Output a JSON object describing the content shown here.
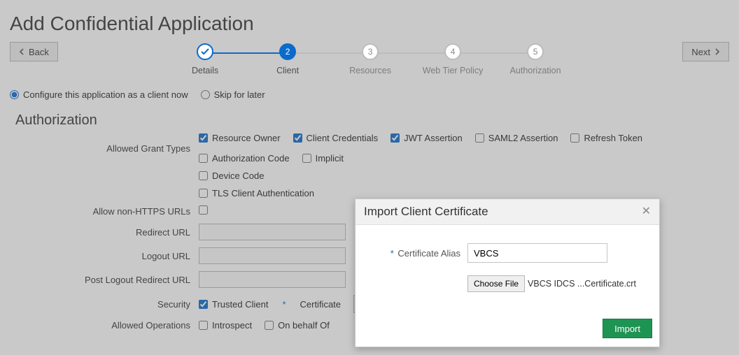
{
  "header": {
    "title": "Add Confidential Application",
    "back_label": "Back",
    "next_label": "Next"
  },
  "stepper": {
    "steps": [
      {
        "num_icon": "check",
        "label": "Details"
      },
      {
        "num_icon": "2",
        "label": "Client"
      },
      {
        "num_icon": "3",
        "label": "Resources"
      },
      {
        "num_icon": "4",
        "label": "Web Tier Policy"
      },
      {
        "num_icon": "5",
        "label": "Authorization"
      }
    ]
  },
  "config_choice": {
    "now_label": "Configure this application as a client now",
    "later_label": "Skip for later"
  },
  "auth": {
    "section_title": "Authorization",
    "allowed_grant_types_label": "Allowed Grant Types",
    "grant_types": {
      "resource_owner": "Resource Owner",
      "client_credentials": "Client Credentials",
      "jwt_assertion": "JWT Assertion",
      "saml2_assertion": "SAML2 Assertion",
      "refresh_token": "Refresh Token",
      "authorization_code": "Authorization Code",
      "implicit": "Implicit",
      "device_code": "Device Code",
      "tls_client_auth": "TLS Client Authentication"
    },
    "allow_non_https_label": "Allow non-HTTPS URLs",
    "redirect_url_label": "Redirect URL",
    "logout_url_label": "Logout URL",
    "post_logout_redirect_url_label": "Post Logout Redirect URL",
    "security_label": "Security",
    "trusted_client_label": "Trusted Client",
    "certificate_label": "Certificate",
    "import_button": "Import",
    "allowed_ops_label": "Allowed Operations",
    "introspect_label": "Introspect",
    "on_behalf_label": "On behalf Of"
  },
  "modal": {
    "title": "Import Client Certificate",
    "cert_alias_label": "Certificate Alias",
    "cert_alias_value": "VBCS",
    "choose_file_label": "Choose File",
    "file_name": "VBCS IDCS ...Certificate.crt",
    "import_label": "Import"
  }
}
